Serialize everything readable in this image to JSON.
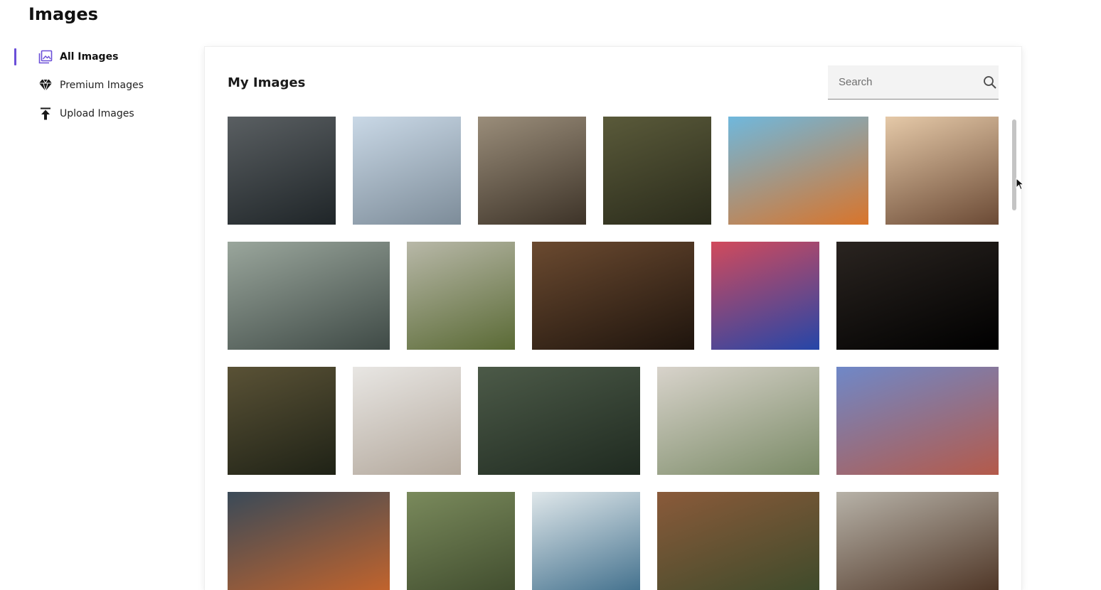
{
  "page": {
    "title": "Images"
  },
  "sidebar": {
    "items": [
      {
        "label": "All Images",
        "icon": "image-gallery-icon",
        "active": true
      },
      {
        "label": "Premium Images",
        "icon": "diamond-icon",
        "active": false
      },
      {
        "label": "Upload Images",
        "icon": "upload-icon",
        "active": false
      }
    ]
  },
  "main": {
    "title": "My Images",
    "search": {
      "placeholder": "Search",
      "icon": "search-icon"
    }
  },
  "colors": {
    "accent": "#6b4fd8",
    "search_bg": "#f3f3f3"
  },
  "gallery": {
    "rows": [
      [
        {
          "name": "woman-in-lake",
          "c1": "#5a5f62",
          "c2": "#1f2528"
        },
        {
          "name": "couple-in-snow",
          "c1": "#c9d8e6",
          "c2": "#7d8c99"
        },
        {
          "name": "dining-room-window",
          "c1": "#9a8d7a",
          "c2": "#3d3328"
        },
        {
          "name": "flower-basket",
          "c1": "#5a5a3a",
          "c2": "#2a2b1b"
        },
        {
          "name": "orange-building",
          "c1": "#6fb8dd",
          "c2": "#d9742a"
        },
        {
          "name": "dessert-plates",
          "c1": "#e5c9a8",
          "c2": "#6b4a35"
        }
      ],
      [
        {
          "name": "friends-on-bed",
          "c1": "#9aa69c",
          "c2": "#3f4a46"
        },
        {
          "name": "woman-in-grass",
          "c1": "#b8b8a8",
          "c2": "#5a6a35"
        },
        {
          "name": "woman-with-laptop-window",
          "c1": "#6b4a30",
          "c2": "#1e140d"
        },
        {
          "name": "man-neon-light",
          "c1": "#d14a5c",
          "c2": "#2546a8"
        },
        {
          "name": "coin-stack",
          "c1": "#2a2420",
          "c2": "#000000"
        }
      ],
      [
        {
          "name": "dandelion-magnifier",
          "c1": "#5a5236",
          "c2": "#1f2216"
        },
        {
          "name": "calico-cat",
          "c1": "#e8e6e3",
          "c2": "#b3a89c"
        },
        {
          "name": "green-leaves",
          "c1": "#4c5a48",
          "c2": "#1f2a20"
        },
        {
          "name": "women-on-couch",
          "c1": "#d8d3cb",
          "c2": "#7a8a66"
        },
        {
          "name": "canyon-waterfall",
          "c1": "#6f88c8",
          "c2": "#b45a4a"
        }
      ],
      [
        {
          "name": "couple-with-tablet",
          "c1": "#3a4a58",
          "c2": "#c9652a"
        },
        {
          "name": "poppy-in-wheat",
          "c1": "#7a8a5c",
          "c2": "#3e4a2c"
        },
        {
          "name": "abstract-marble",
          "c1": "#dfe7ea",
          "c2": "#3a6a88"
        },
        {
          "name": "waterfall-cliffs",
          "c1": "#8a5a3a",
          "c2": "#3b4a2a"
        },
        {
          "name": "woman-laptop-desk",
          "c1": "#b7b2a8",
          "c2": "#4a3020"
        }
      ]
    ]
  }
}
